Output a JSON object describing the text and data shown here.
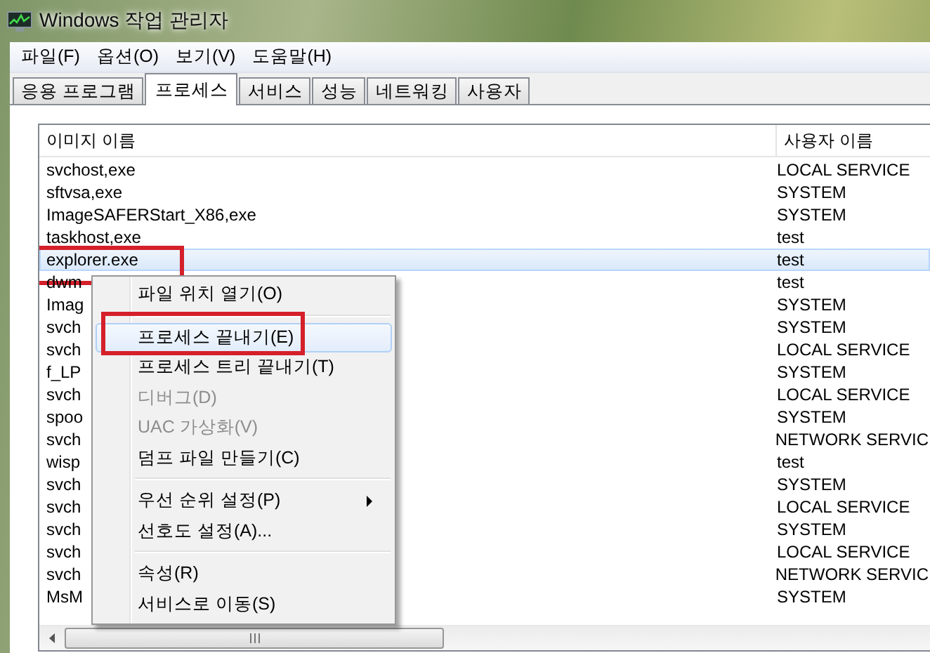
{
  "window": {
    "title": "Windows 작업 관리자"
  },
  "menu_bar": [
    "파일(F)",
    "옵션(O)",
    "보기(V)",
    "도움말(H)"
  ],
  "tabs": [
    {
      "label": "응용 프로그램",
      "selected": false
    },
    {
      "label": "프로세스",
      "selected": true
    },
    {
      "label": "서비스",
      "selected": false
    },
    {
      "label": "성능",
      "selected": false
    },
    {
      "label": "네트워킹",
      "selected": false
    },
    {
      "label": "사용자",
      "selected": false
    }
  ],
  "process_list": {
    "columns": [
      "이미지 이름",
      "사용자 이름"
    ],
    "rows": [
      {
        "image_name": "svchost,exe",
        "user_name": "LOCAL SERVICE",
        "selected": false,
        "highlighted": false
      },
      {
        "image_name": "sftvsa,exe",
        "user_name": "SYSTEM",
        "selected": false,
        "highlighted": false
      },
      {
        "image_name": "ImageSAFERStart_X86,exe",
        "user_name": "SYSTEM",
        "selected": false,
        "highlighted": false
      },
      {
        "image_name": "taskhost,exe",
        "user_name": "test",
        "selected": false,
        "highlighted": false
      },
      {
        "image_name": "explorer.exe",
        "user_name": "test",
        "selected": true,
        "highlighted": true
      },
      {
        "image_name": "dwm",
        "user_name": "test",
        "selected": false,
        "highlighted": false
      },
      {
        "image_name": "Imag",
        "user_name": "SYSTEM",
        "selected": false,
        "highlighted": false
      },
      {
        "image_name": "svch",
        "user_name": "SYSTEM",
        "selected": false,
        "highlighted": false
      },
      {
        "image_name": "svch",
        "user_name": "LOCAL SERVICE",
        "selected": false,
        "highlighted": false
      },
      {
        "image_name": "f_LP",
        "user_name": "SYSTEM",
        "selected": false,
        "highlighted": false
      },
      {
        "image_name": "svch",
        "user_name": "LOCAL SERVICE",
        "selected": false,
        "highlighted": false
      },
      {
        "image_name": "spoo",
        "user_name": "SYSTEM",
        "selected": false,
        "highlighted": false
      },
      {
        "image_name": "svch",
        "user_name": "NETWORK SERVIC",
        "selected": false,
        "highlighted": false
      },
      {
        "image_name": "wisp",
        "user_name": "test",
        "selected": false,
        "highlighted": false
      },
      {
        "image_name": "svch",
        "user_name": "SYSTEM",
        "selected": false,
        "highlighted": false
      },
      {
        "image_name": "svch",
        "user_name": "LOCAL SERVICE",
        "selected": false,
        "highlighted": false
      },
      {
        "image_name": "svch",
        "user_name": "SYSTEM",
        "selected": false,
        "highlighted": false
      },
      {
        "image_name": "svch",
        "user_name": "LOCAL SERVICE",
        "selected": false,
        "highlighted": false
      },
      {
        "image_name": "svch",
        "user_name": "NETWORK SERVIC",
        "selected": false,
        "highlighted": false
      },
      {
        "image_name": "MsM",
        "user_name": "SYSTEM",
        "selected": false,
        "highlighted": false
      }
    ]
  },
  "context_menu": {
    "items": [
      {
        "kind": "item",
        "label": "파일 위치 열기(O)",
        "disabled": false,
        "hovered": false,
        "highlighted": false,
        "submenu": false
      },
      {
        "kind": "separator"
      },
      {
        "kind": "item",
        "label": "프로세스 끝내기(E)",
        "disabled": false,
        "hovered": true,
        "highlighted": true,
        "submenu": false
      },
      {
        "kind": "item",
        "label": "프로세스 트리 끝내기(T)",
        "disabled": false,
        "hovered": false,
        "highlighted": false,
        "submenu": false
      },
      {
        "kind": "item",
        "label": "디버그(D)",
        "disabled": true,
        "hovered": false,
        "highlighted": false,
        "submenu": false
      },
      {
        "kind": "item",
        "label": "UAC 가상화(V)",
        "disabled": true,
        "hovered": false,
        "highlighted": false,
        "submenu": false
      },
      {
        "kind": "item",
        "label": "덤프 파일 만들기(C)",
        "disabled": false,
        "hovered": false,
        "highlighted": false,
        "submenu": false
      },
      {
        "kind": "separator"
      },
      {
        "kind": "item",
        "label": "우선 순위 설정(P)",
        "disabled": false,
        "hovered": false,
        "highlighted": false,
        "submenu": true
      },
      {
        "kind": "item",
        "label": "선호도 설정(A)...",
        "disabled": false,
        "hovered": false,
        "highlighted": false,
        "submenu": false
      },
      {
        "kind": "separator"
      },
      {
        "kind": "item",
        "label": "속성(R)",
        "disabled": false,
        "hovered": false,
        "highlighted": false,
        "submenu": false
      },
      {
        "kind": "item",
        "label": "서비스로 이동(S)",
        "disabled": false,
        "hovered": false,
        "highlighted": false,
        "submenu": false
      }
    ]
  }
}
